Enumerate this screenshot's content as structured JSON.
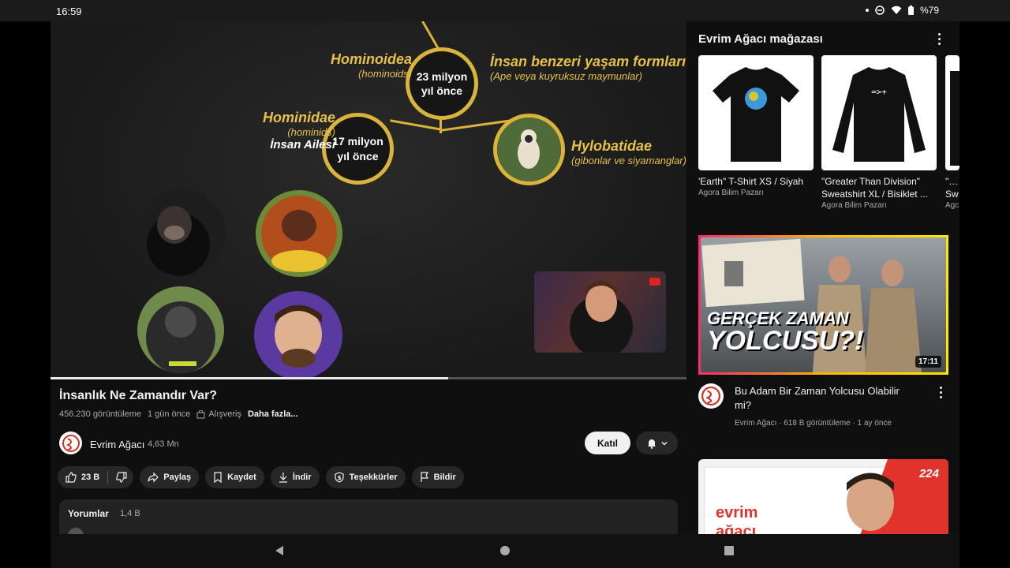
{
  "status_bar": {
    "time": "16:59",
    "battery": "%79",
    "icons": [
      "dot-icon",
      "dnd-icon",
      "wifi-icon",
      "battery-icon"
    ]
  },
  "player": {
    "progress": 0.625,
    "diagram": {
      "node_top": "23 milyon\nyıl önce",
      "node_left": "17 milyon\nyıl önce",
      "label_hominoidea": "Hominoidea",
      "label_hominoidea_sub": "(hominoids)",
      "label_humanlike": "İnsan benzeri yaşam formları",
      "label_humanlike_sub": "(Ape veya kuyruksuz maymunlar)",
      "label_hominidae": "Hominidae",
      "label_hominidae_sub": "(hominids)",
      "label_family": "İnsan Ailesi",
      "label_hylobatidae": "Hylobatidae",
      "label_hylobatidae_sub": "(gibonlar ve siyamanglar)"
    }
  },
  "video": {
    "title": "İnsanlık Ne Zamandır Var?",
    "views": "456.230 görüntüleme",
    "age": "1 gün önce",
    "shopping": "Alışveriş",
    "more": "Daha fazla..."
  },
  "channel": {
    "name": "Evrim Ağacı",
    "subscribers": "4,63 Mn",
    "join_label": "Katıl"
  },
  "actions": {
    "likes": "23 B",
    "share": "Paylaş",
    "save": "Kaydet",
    "download": "İndir",
    "thanks": "Teşekkürler",
    "report": "Bildir"
  },
  "comments": {
    "title": "Yorumlar",
    "count": "1,4 B"
  },
  "shop": {
    "title": "Evrim Ağacı mağazası",
    "products": [
      {
        "name": "'Earth\" T-Shirt XS / Siyah",
        "seller": "Agora Bilim Pazarı"
      },
      {
        "name": "\"Greater Than Division\" Sweatshirt XL / Bisiklet ...",
        "seller": "Agora Bilim Pazarı"
      },
      {
        "name": "\"Pe Sw",
        "seller": "Agc"
      }
    ]
  },
  "related": [
    {
      "thumb_line1": "GERÇEK ZAMAN",
      "thumb_line2": "YOLCUSU?!",
      "duration": "17:11",
      "title": "Bu Adam Bir Zaman Yolcusu Olabilir mi?",
      "meta": "Evrim Ağacı · 618 B görüntüleme · 1 ay önce"
    },
    {
      "thumb_text": "evrim ağacı",
      "badge": "224"
    }
  ],
  "colors": {
    "accent_gold": "#d9b33a",
    "background": "#0f0f0f",
    "chip": "#272727"
  }
}
